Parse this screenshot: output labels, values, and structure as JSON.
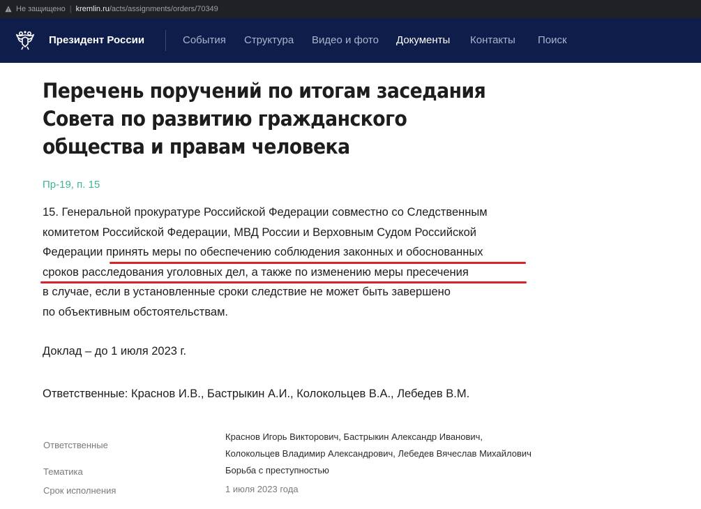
{
  "browser": {
    "security_label": "Не защищено",
    "host": "kremlin.ru",
    "path": "/acts/assignments/orders/70349"
  },
  "nav": {
    "brand": "Президент России",
    "items": [
      "События",
      "Структура",
      "Видео и фото",
      "Документы",
      "Контакты",
      "Поиск"
    ],
    "active_item": "Документы"
  },
  "article": {
    "title": "Перечень поручений по итогам заседания Совета по развитию гражданского общества и правам человека",
    "doc_ref": "Пр-19, п. 15",
    "paragraph_lines": [
      "15. Генеральной прокуратуре Российской Федерации совместно со Следственным",
      "комитетом Российской Федерации, МВД России и Верховным Судом Российской",
      "Федерации принять меры по обеспечению соблюдения законных и обоснованных",
      "сроков расследования уголовных дел, а также по изменению меры пресечения",
      "в случае, если в установленные сроки следствие не может быть завершено",
      "по объективным обстоятельствам."
    ],
    "deadline": "Доклад – до 1 июля 2023 г.",
    "responsible": "Ответственные: Краснов И.В., Бастрыкин А.И., Колокольцев В.А., Лебедев В.М."
  },
  "meta": {
    "responsible_label": "Ответственные",
    "responsible_value_lines": [
      "Краснов Игорь Викторович, Бастрыкин Александр Иванович,",
      "Колокольцев Владимир Александрович, Лебедев Вячеслав Михайлович"
    ],
    "topic_label": "Тематика",
    "topic_value": "Борьба с преступностью",
    "due_label": "Срок исполнения",
    "due_value": "1 июля 2023 года"
  },
  "colors": {
    "nav_bg": "#0e1d4a",
    "doc_ref": "#3fb29c",
    "underline": "#d8232a"
  }
}
